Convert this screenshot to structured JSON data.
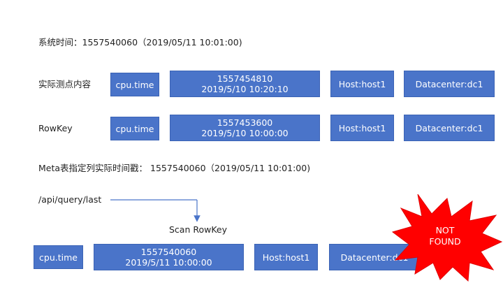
{
  "system_time_label": "系统时间：1557540060（2019/05/11 10:01:00)",
  "rows": [
    {
      "label": "实际测点内容",
      "metric": "cpu.time",
      "ts_line1": "1557454810",
      "ts_line2": "2019/5/10 10:20:10",
      "host": "Host:host1",
      "datacenter": "Datacenter:dc1"
    },
    {
      "label": "RowKey",
      "metric": "cpu.time",
      "ts_line1": "1557453600",
      "ts_line2": "2019/5/10 10:00:00",
      "host": "Host:host1",
      "datacenter": "Datacenter:dc1"
    }
  ],
  "meta_label": "Meta表指定列实际时间戳： 1557540060（2019/05/11 10:01:00)",
  "api_label": "/api/query/last",
  "scan_label": "Scan RowKey",
  "scan_row": {
    "metric": "cpu.time",
    "ts_line1": "1557540060",
    "ts_line2": "2019/5/11 10:00:00",
    "host": "Host:host1",
    "datacenter": "Datacenter:dc1"
  },
  "not_found": {
    "line1": "NOT",
    "line2": "FOUND"
  },
  "colors": {
    "box_fill": "#4a74c9",
    "star_fill": "#ff0000",
    "arrow": "#4a74c9"
  }
}
